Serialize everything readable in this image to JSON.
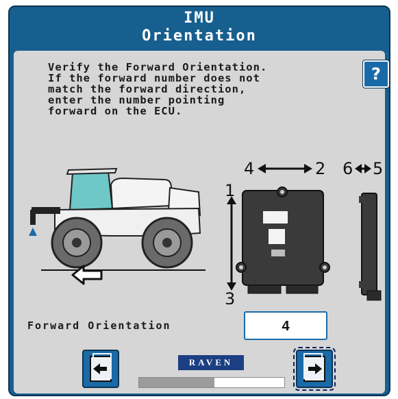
{
  "header": {
    "title_line1": "IMU",
    "title_line2": "Orientation"
  },
  "instructions": "Verify the Forward Orientation.\nIf the forward number does not\nmatch the forward direction,\nenter the number pointing\nforward on the ECU.",
  "help": {
    "label": "?"
  },
  "diagram": {
    "label_4": "4",
    "label_2": "2",
    "label_6": "6",
    "label_5": "5",
    "label_1": "1",
    "label_3": "3"
  },
  "forward_orientation": {
    "label": "Forward Orientation",
    "value": "4"
  },
  "logo": {
    "text": "RAVEN"
  },
  "progress": {
    "fraction": 0.52
  },
  "colors": {
    "header": "#175f8f",
    "panel": "#d6d6d6",
    "button": "#1b6aa8",
    "logo": "#1b3f82"
  },
  "icons": {
    "back": "back-arrow-icon",
    "next": "next-arrow-icon",
    "help": "help-icon",
    "forward": "forward-arrow-icon"
  }
}
